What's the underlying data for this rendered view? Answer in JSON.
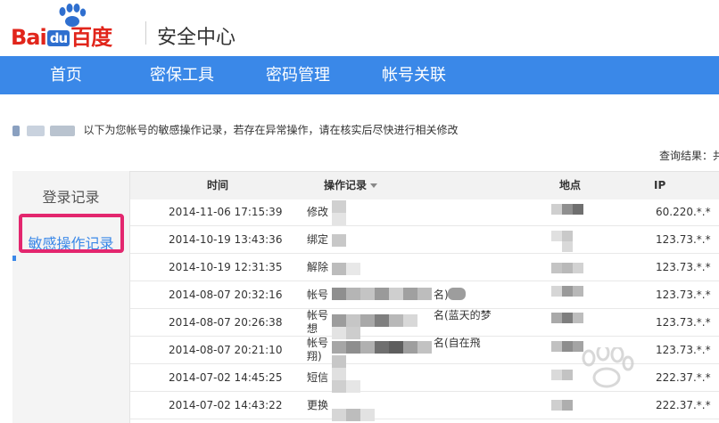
{
  "header": {
    "logo_text": "Bai",
    "logo_du": "du",
    "logo_cn": "百度",
    "title": "安全中心"
  },
  "nav": {
    "items": [
      {
        "label": "首页"
      },
      {
        "label": "密保工具"
      },
      {
        "label": "密码管理"
      },
      {
        "label": "帐号关联"
      }
    ]
  },
  "intro": {
    "text": "以下为您帐号的敏感操作记录，若存在异常操作，请在核实后尽快进行相关修改"
  },
  "result": {
    "label": "查询结果：共"
  },
  "side": {
    "tabs": [
      {
        "label": "登录记录"
      },
      {
        "label": "敏感操作记录"
      }
    ]
  },
  "table": {
    "columns": [
      "时间",
      "操作记录",
      "地点",
      "IP"
    ],
    "rows": [
      {
        "time": "2014-11-06 17:15:39",
        "op": "修改",
        "ip": "60.220.*.*"
      },
      {
        "time": "2014-10-19 13:43:36",
        "op": "绑定",
        "ip": "123.73.*.*"
      },
      {
        "time": "2014-10-19 12:31:35",
        "op": "解除",
        "ip": "123.73.*.*"
      },
      {
        "time": "2014-08-07 20:32:16",
        "op": "帐号",
        "op_tail": "名)",
        "ip": "123.73.*.*"
      },
      {
        "time": "2014-08-07 20:26:38",
        "op": "帐号",
        "op_line2": "想",
        "op_tail": "名(蓝天的梦",
        "ip": "123.73.*.*"
      },
      {
        "time": "2014-08-07 20:21:10",
        "op": "帐号",
        "op_line2": "翔)",
        "op_tail": "名(自在飛",
        "ip": "123.73.*.*"
      },
      {
        "time": "2014-07-02 14:45:25",
        "op": "短信",
        "ip": "222.37.*.*"
      },
      {
        "time": "2014-07-02 14:43:22",
        "op": "更换",
        "ip": "222.37.*.*"
      }
    ]
  },
  "icons": {
    "paw": "baidu-paw-icon",
    "sort": "sort-down-icon"
  },
  "colors": {
    "brand_red": "#e1251b",
    "brand_blue": "#3a88e8",
    "highlight": "#e3266e"
  }
}
